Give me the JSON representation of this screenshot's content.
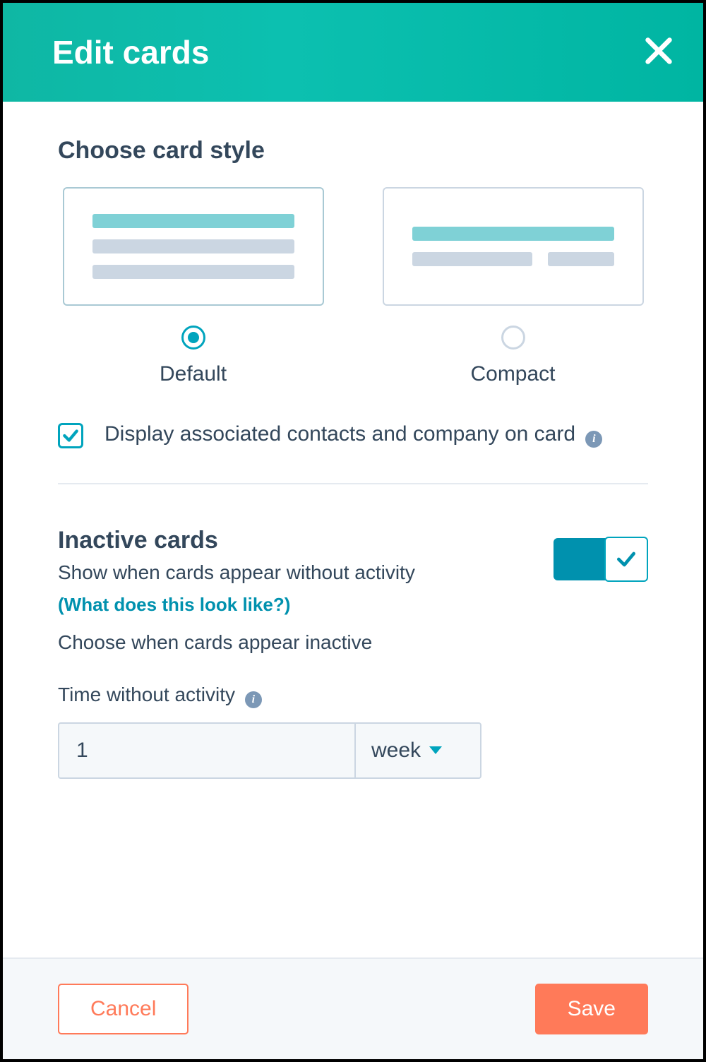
{
  "header": {
    "title": "Edit cards"
  },
  "style": {
    "section_title": "Choose card style",
    "options": [
      {
        "label": "Default",
        "selected": true
      },
      {
        "label": "Compact",
        "selected": false
      }
    ],
    "checkbox": {
      "checked": true,
      "label": "Display associated contacts and company on card"
    }
  },
  "inactive": {
    "section_title": "Inactive cards",
    "subtitle": "Show when cards appear without activity",
    "help_link": "(What does this look like?)",
    "choose_text": "Choose when cards appear inactive",
    "field_label": "Time without activity",
    "value": "1",
    "unit": "week",
    "toggle_on": true
  },
  "footer": {
    "cancel": "Cancel",
    "save": "Save"
  }
}
